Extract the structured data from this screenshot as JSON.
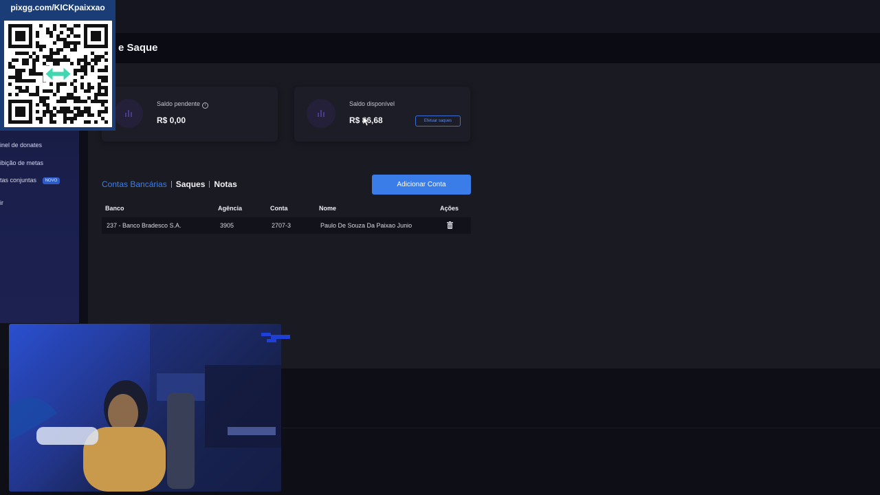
{
  "header": {
    "title": "e Saque"
  },
  "sidebar": {
    "items": [
      {
        "label": "inel de donates"
      },
      {
        "label": "ibição de metas"
      },
      {
        "label": "tas conjuntas",
        "badge": "NOVO"
      },
      {
        "label": "ir"
      }
    ]
  },
  "balances": {
    "pending": {
      "label": "Saldo pendente",
      "value": "R$ 0,00"
    },
    "available": {
      "label": "Saldo disponível",
      "value": "R$ 86,68",
      "button": "Efetuar saques"
    }
  },
  "tabs": {
    "items": [
      {
        "label": "Contas Bancárias",
        "active": true
      },
      {
        "label": "Saques",
        "active": false
      },
      {
        "label": "Notas",
        "active": false
      }
    ]
  },
  "add_account_label": "Adicionar Conta",
  "table": {
    "headers": {
      "bank": "Banco",
      "agency": "Agência",
      "account": "Conta",
      "name": "Nome",
      "actions": "Ações"
    },
    "rows": [
      {
        "bank": "237 - Banco Bradesco S.A.",
        "agency": "3905",
        "account": "2707-3",
        "name": "Paulo De Souza Da Paixao Junio",
        "action_icon": "trash-icon"
      }
    ]
  },
  "overlay": {
    "qr_title": "pixgg.com/KICKpaixxao",
    "qr_icon": "qr-code-icon"
  },
  "colors": {
    "accent": "#3a7ce8",
    "link": "#3f7fe8",
    "sidebar": "#1a1f4c"
  }
}
